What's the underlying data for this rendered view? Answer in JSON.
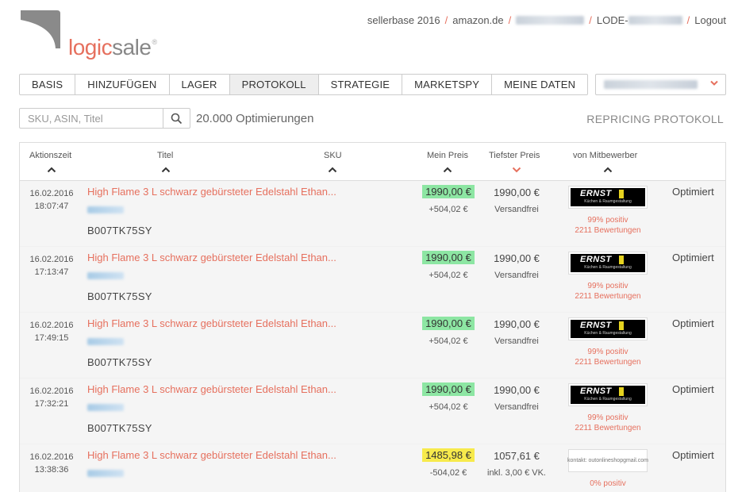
{
  "brand": {
    "logo_left": "logic",
    "logo_right": "sale",
    "reg": "®"
  },
  "topnav": {
    "sellerbase": "sellerbase 2016",
    "marketplace": "amazon.de",
    "account_prefix": "LODE-",
    "logout": "Logout"
  },
  "tabs": [
    {
      "label": "BASIS"
    },
    {
      "label": "HINZUFÜGEN"
    },
    {
      "label": "LAGER"
    },
    {
      "label": "PROTOKOLL",
      "active": true
    },
    {
      "label": "STRATEGIE"
    },
    {
      "label": "MARKETSPY"
    },
    {
      "label": "MEINE DATEN"
    }
  ],
  "search": {
    "placeholder": "SKU, ASIN, Titel"
  },
  "count": "20.000 Optimierungen",
  "section_title": "REPRICING PROTOKOLL",
  "columns": {
    "time": "Aktionszeit",
    "title": "Titel",
    "sku": "SKU",
    "my_price": "Mein Preis",
    "lowest_price": "Tiefster Preis",
    "competitor": "von Mitbewerber"
  },
  "colors": {
    "accent": "#e6705e",
    "price_green": "#8de6a3",
    "price_yellow": "#f7ea4c"
  },
  "rows": [
    {
      "date": "16.02.2016",
      "time": "18:07:47",
      "title": "High Flame 3 L schwarz gebürsteter Edelstahl Ethan...",
      "asin": "B007TK75SY",
      "price": "1990,00 €",
      "price_state": "green",
      "diff": "+504,02 €",
      "lowest": "1990,00 €",
      "shipping": "Versandfrei",
      "competitor": "ernst",
      "positive": "99% positiv",
      "reviews": "2211 Bewertungen",
      "status": "Optimiert"
    },
    {
      "date": "16.02.2016",
      "time": "17:13:47",
      "title": "High Flame 3 L schwarz gebürsteter Edelstahl Ethan...",
      "asin": "B007TK75SY",
      "price": "1990,00 €",
      "price_state": "green",
      "diff": "+504,02 €",
      "lowest": "1990,00 €",
      "shipping": "Versandfrei",
      "competitor": "ernst",
      "positive": "99% positiv",
      "reviews": "2211 Bewertungen",
      "status": "Optimiert"
    },
    {
      "date": "16.02.2016",
      "time": "17:49:15",
      "title": "High Flame 3 L schwarz gebürsteter Edelstahl Ethan...",
      "asin": "B007TK75SY",
      "price": "1990,00 €",
      "price_state": "green",
      "diff": "+504,02 €",
      "lowest": "1990,00 €",
      "shipping": "Versandfrei",
      "competitor": "ernst",
      "positive": "99% positiv",
      "reviews": "2211 Bewertungen",
      "status": "Optimiert"
    },
    {
      "date": "16.02.2016",
      "time": "17:32:21",
      "title": "High Flame 3 L schwarz gebürsteter Edelstahl Ethan...",
      "asin": "B007TK75SY",
      "price": "1990,00 €",
      "price_state": "green",
      "diff": "+504,02 €",
      "lowest": "1990,00 €",
      "shipping": "Versandfrei",
      "competitor": "ernst",
      "positive": "99% positiv",
      "reviews": "2211 Bewertungen",
      "status": "Optimiert"
    },
    {
      "date": "16.02.2016",
      "time": "13:38:36",
      "title": "High Flame 3 L schwarz gebürsteter Edelstahl Ethan...",
      "asin": "",
      "price": "1485,98 €",
      "price_state": "yellow",
      "diff": "-504,02 €",
      "lowest": "1057,61 €",
      "shipping": "inkl. 3,00 € VK.",
      "competitor": "text",
      "competitor_text": "kontakt: outonlineshopgmail.com",
      "positive": "0% positiv",
      "reviews": "",
      "status": "Optimiert"
    }
  ],
  "competitor_logo": {
    "name": "ERNST",
    "sub": "Küchen & Raumgestaltung"
  }
}
